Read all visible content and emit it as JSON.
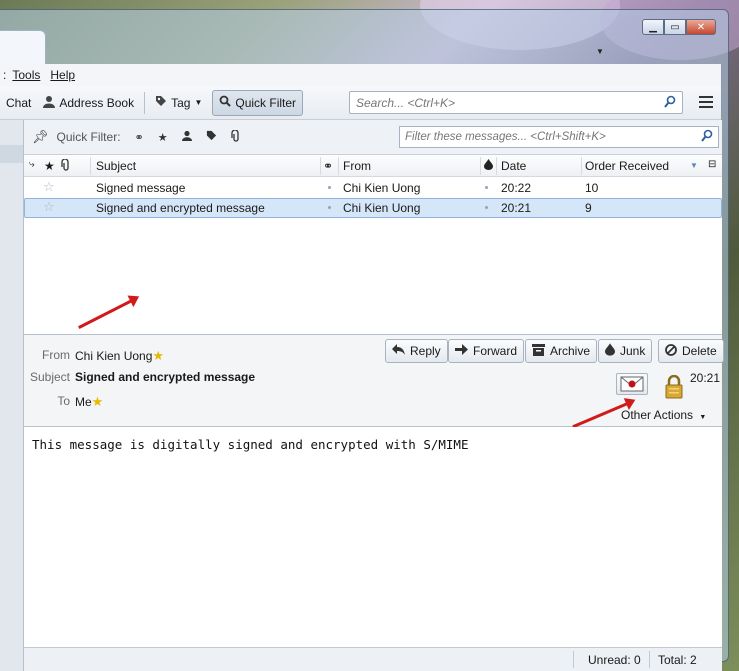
{
  "menubar": {
    "items": [
      {
        "label": "Tools",
        "underline": true
      },
      {
        "label": "Help",
        "underline": true
      }
    ]
  },
  "toolbar": {
    "chat_label": "Chat",
    "address_book_label": "Address Book",
    "tag_label": "Tag",
    "quick_filter_label": "Quick Filter",
    "search_placeholder": "Search... <Ctrl+K>"
  },
  "quick_filter": {
    "label": "Quick Filter:",
    "filter_placeholder": "Filter these messages... <Ctrl+Shift+K>"
  },
  "thread_pane": {
    "columns": {
      "subject": "Subject",
      "from": "From",
      "date": "Date",
      "order": "Order Received"
    },
    "rows": [
      {
        "subject": "Signed message",
        "from": "Chi Kien Uong",
        "date": "20:22",
        "order": "10",
        "selected": false
      },
      {
        "subject": "Signed and encrypted message",
        "from": "Chi Kien Uong",
        "date": "20:21",
        "order": "9",
        "selected": true
      }
    ]
  },
  "message_header": {
    "from_label": "From",
    "from_value": "Chi Kien Uong",
    "subject_label": "Subject",
    "subject_value": "Signed and encrypted message",
    "to_label": "To",
    "to_value": "Me",
    "time": "20:21",
    "buttons": {
      "reply": "Reply",
      "forward": "Forward",
      "archive": "Archive",
      "junk": "Junk",
      "delete": "Delete"
    },
    "other_actions": "Other Actions"
  },
  "message_body": {
    "text": "This message is digitally signed and encrypted with S/MIME"
  },
  "statusbar": {
    "unread": "Unread: 0",
    "total": "Total: 2"
  },
  "colors": {
    "annotation_arrow": "#d11a1a",
    "selected_row": "#d5e6f8",
    "accent_icon": "#2a5fa0"
  }
}
